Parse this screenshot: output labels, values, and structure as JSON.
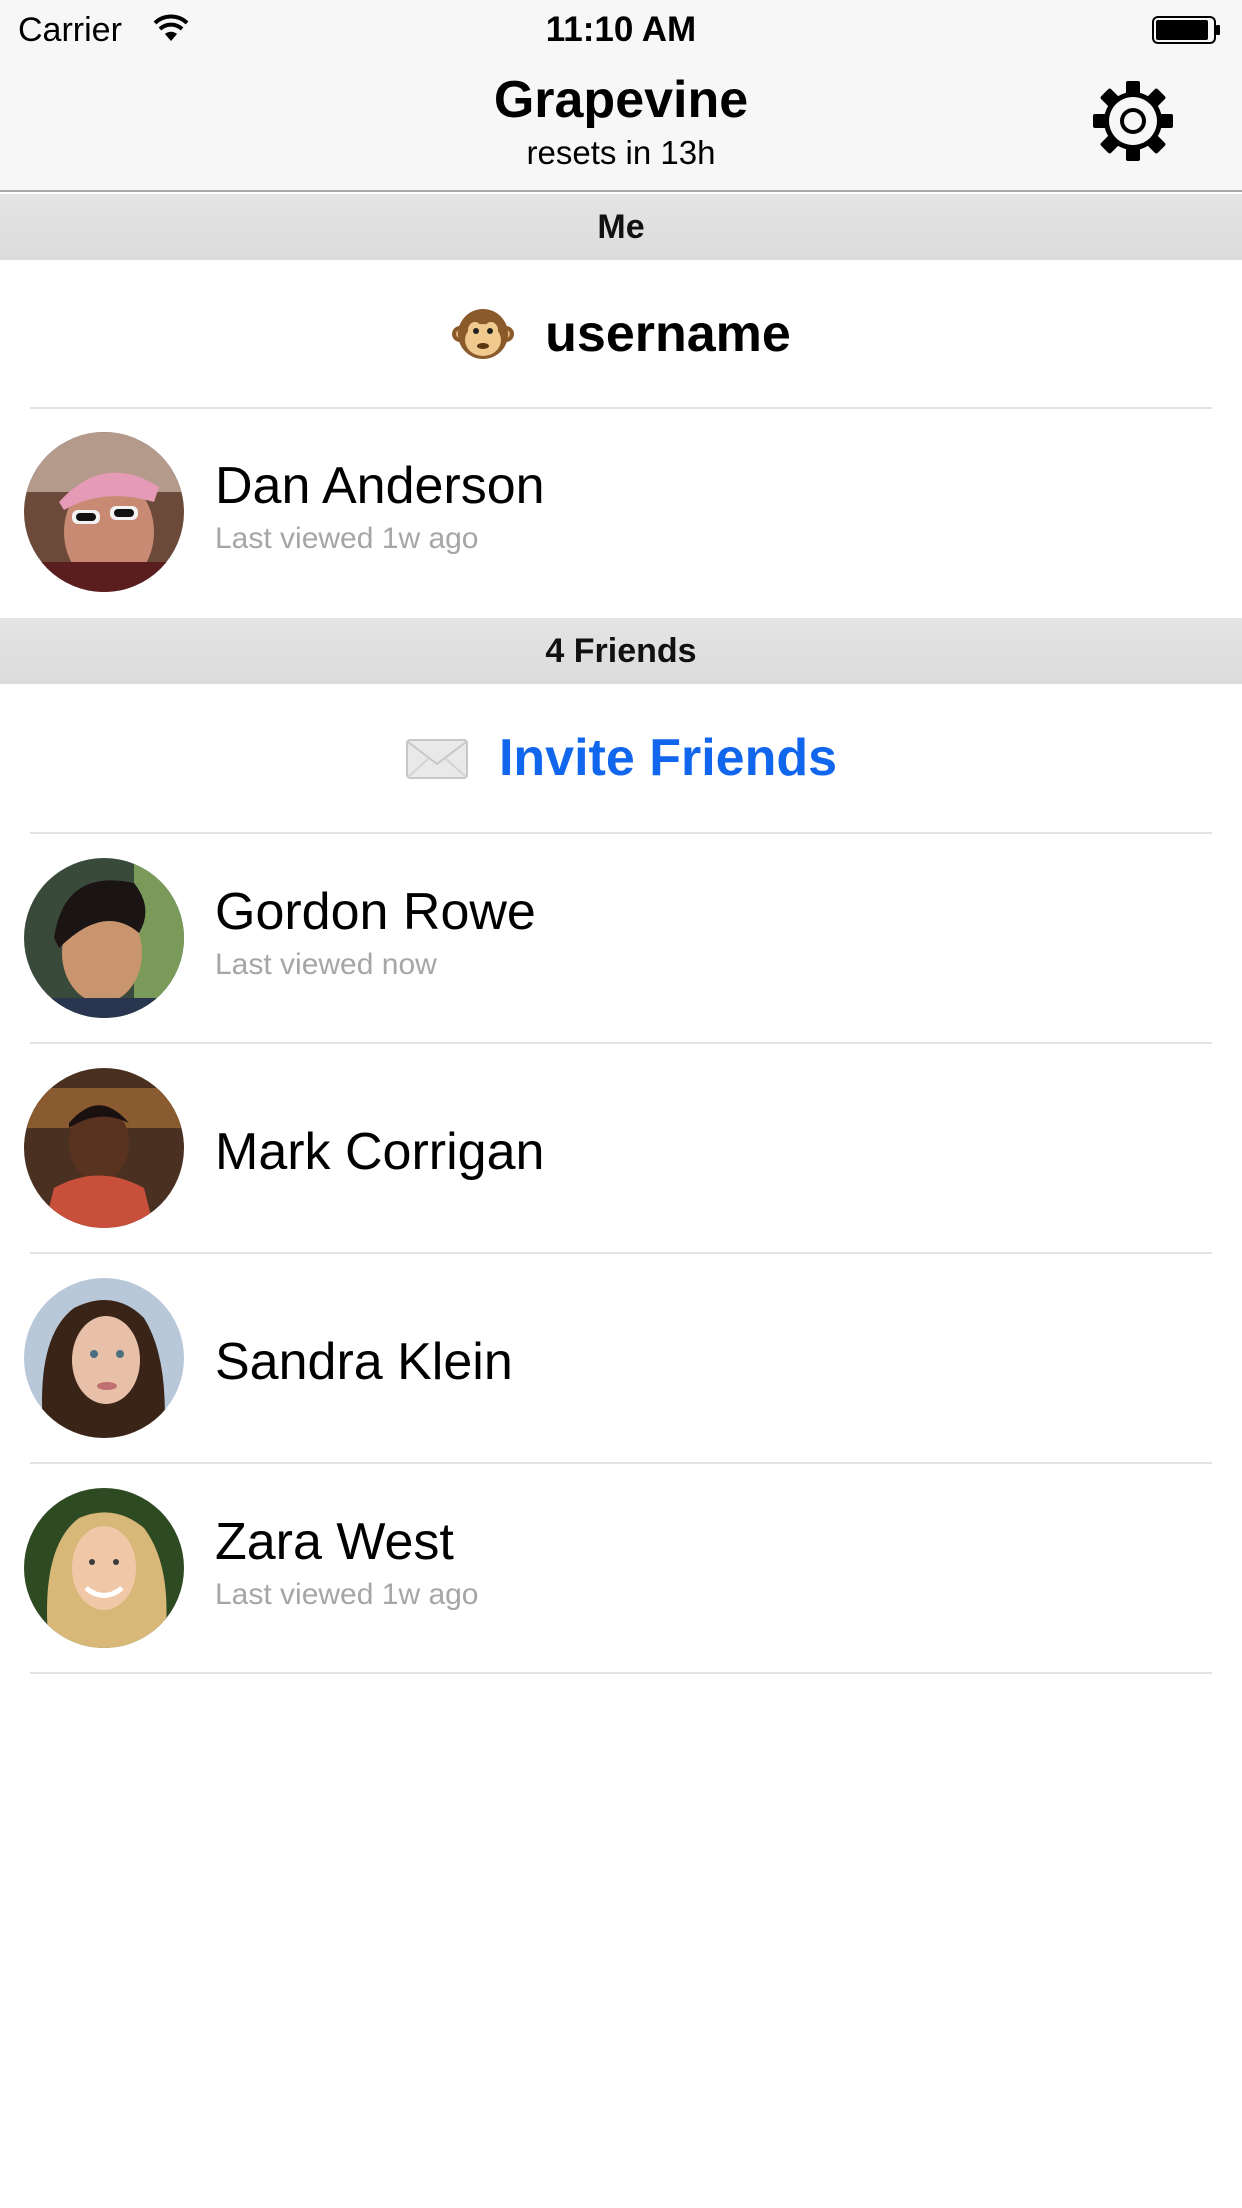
{
  "status_bar": {
    "carrier": "Carrier",
    "time": "11:10 AM"
  },
  "nav": {
    "title": "Grapevine",
    "subtitle": "resets in 13h",
    "settings_icon": "gear-icon"
  },
  "me_section": {
    "header": "Me",
    "username_emoji": "monkey-face-icon",
    "username": "username",
    "profile": {
      "name": "Dan Anderson",
      "last_viewed": "Last viewed 1w ago"
    }
  },
  "friends_section": {
    "header": "4 Friends",
    "invite_icon": "envelope-icon",
    "invite_label": "Invite Friends",
    "friends": [
      {
        "name": "Gordon Rowe",
        "last_viewed": "Last viewed now"
      },
      {
        "name": "Mark Corrigan",
        "last_viewed": ""
      },
      {
        "name": "Sandra Klein",
        "last_viewed": ""
      },
      {
        "name": "Zara West",
        "last_viewed": "Last viewed 1w ago"
      }
    ]
  },
  "colors": {
    "accent": "#1166ee",
    "subtext": "#a6a6a6",
    "bar_background": "#f7f7f7"
  }
}
